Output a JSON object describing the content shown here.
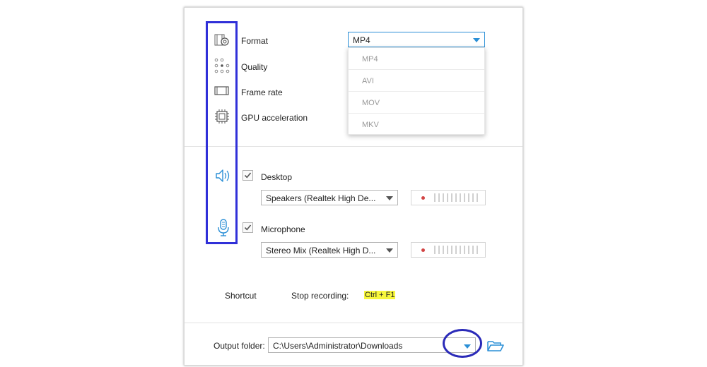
{
  "settings": {
    "format": {
      "label": "Format",
      "value": "MP4",
      "options": [
        "MP4",
        "AVI",
        "MOV",
        "MKV"
      ]
    },
    "quality": {
      "label": "Quality"
    },
    "frame_rate": {
      "label": "Frame rate"
    },
    "gpu": {
      "label": "GPU acceleration"
    }
  },
  "audio": {
    "desktop": {
      "label": "Desktop",
      "checked": true,
      "device": "Speakers (Realtek High De..."
    },
    "microphone": {
      "label": "Microphone",
      "checked": true,
      "device": "Stereo Mix (Realtek High D..."
    }
  },
  "shortcut": {
    "label": "Shortcut",
    "stop_label": "Stop recording:",
    "stop_keys": "Ctrl + F1"
  },
  "output": {
    "label": "Output folder:",
    "path": "C:\\Users\\Administrator\\Downloads"
  },
  "colors": {
    "accent": "#2a8fd6",
    "annotation": "#3030d8",
    "highlight": "#f7f73c"
  }
}
